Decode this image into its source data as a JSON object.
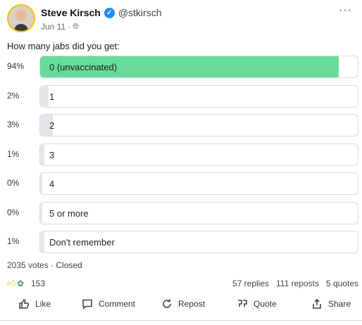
{
  "post": {
    "author_name": "Steve Kirsch",
    "handle": "@stkirsch",
    "date": "Jun 11",
    "separator": "·",
    "more_label": "···"
  },
  "poll": {
    "question": "How many jabs did you get:",
    "options": [
      {
        "percent_label": "94%",
        "label": "0 (unvaccinated)",
        "fraction": 0.94,
        "winner": true
      },
      {
        "percent_label": "2%",
        "label": "1",
        "fraction": 0.02,
        "winner": false
      },
      {
        "percent_label": "3%",
        "label": "2",
        "fraction": 0.03,
        "winner": false
      },
      {
        "percent_label": "1%",
        "label": "3",
        "fraction": 0.01,
        "winner": false
      },
      {
        "percent_label": "0%",
        "label": "4",
        "fraction": 0.0,
        "winner": false
      },
      {
        "percent_label": "0%",
        "label": "5 or more",
        "fraction": 0.0,
        "winner": false
      },
      {
        "percent_label": "1%",
        "label": "Don't remember",
        "fraction": 0.01,
        "winner": false
      }
    ],
    "summary": "2035 votes · Closed"
  },
  "stats": {
    "reactions_count": "153",
    "replies": "57 replies",
    "reposts": "111 reposts",
    "quotes": "5 quotes"
  },
  "actions": {
    "like": "Like",
    "comment": "Comment",
    "repost": "Repost",
    "quote": "Quote",
    "share": "Share"
  },
  "colors": {
    "winner_fill": "#68dd9b",
    "other_fill": "#e4e6ea",
    "verified": "#1d8cf0",
    "avatar_ring": "#f2c200"
  },
  "icons": {
    "verified": "verified-check-icon",
    "globe": "globe-icon",
    "like": "thumbs-up-icon",
    "comment": "comment-icon",
    "repost": "repost-icon",
    "quote": "quote-icon",
    "share": "share-icon"
  }
}
